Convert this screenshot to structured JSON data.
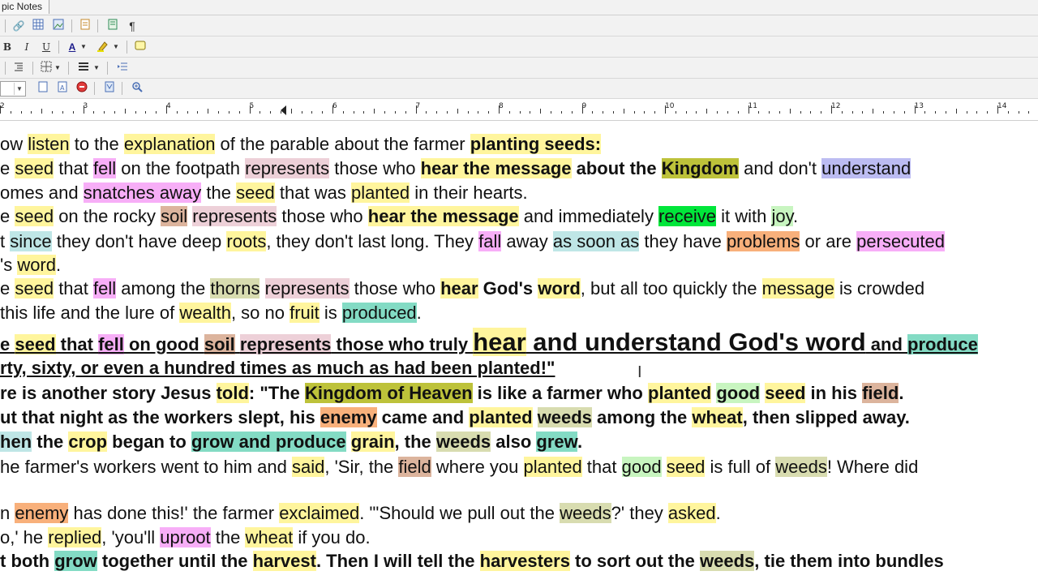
{
  "window": {
    "tab_title": "pic Notes"
  },
  "toolbar": {
    "bold": "B",
    "italic": "I",
    "underline": "U",
    "font_color": "A",
    "pilcrow": "¶"
  },
  "ruler": {
    "numbers": [
      "2",
      "3",
      "4",
      "5",
      "6",
      "7",
      "8",
      "9",
      "10",
      "11",
      "12",
      "13",
      "14"
    ]
  },
  "document": {
    "lines": [
      {
        "bold": false,
        "segments": [
          {
            "t": "ow ",
            "h": ""
          },
          {
            "t": "listen",
            "h": "hy"
          },
          {
            "t": " to the ",
            "h": ""
          },
          {
            "t": "explanation",
            "h": "hy"
          },
          {
            "t": " of the parable about the farmer ",
            "h": ""
          },
          {
            "t": "planting seeds:  ",
            "h": "hy",
            "b": true
          }
        ]
      },
      {
        "bold": false,
        "segments": [
          {
            "t": "e ",
            "h": ""
          },
          {
            "t": "seed",
            "h": "hy"
          },
          {
            "t": " that ",
            "h": ""
          },
          {
            "t": "fell",
            "h": "hp"
          },
          {
            "t": " on the footpath ",
            "h": ""
          },
          {
            "t": "represents",
            "h": "hr"
          },
          {
            "t": " those who ",
            "h": ""
          },
          {
            "t": "hear the message",
            "h": "hy",
            "b": true
          },
          {
            "t": " about the ",
            "h": "",
            "b": true
          },
          {
            "t": "Kingdom",
            "h": "hk",
            "b": true
          },
          {
            "t": " and don't ",
            "h": ""
          },
          {
            "t": "understand",
            "h": "hb"
          }
        ]
      },
      {
        "bold": false,
        "segments": [
          {
            "t": "omes and ",
            "h": ""
          },
          {
            "t": "snatches away",
            "h": "hp"
          },
          {
            "t": " the ",
            "h": ""
          },
          {
            "t": "seed",
            "h": "hy"
          },
          {
            "t": " that was ",
            "h": ""
          },
          {
            "t": "planted",
            "h": "hy"
          },
          {
            "t": " in their hearts.",
            "h": ""
          }
        ]
      },
      {
        "bold": false,
        "segments": [
          {
            "t": "e ",
            "h": ""
          },
          {
            "t": "seed",
            "h": "hy"
          },
          {
            "t": " on the rocky ",
            "h": ""
          },
          {
            "t": "soil",
            "h": "hbr"
          },
          {
            "t": " ",
            "h": ""
          },
          {
            "t": "represents",
            "h": "hr"
          },
          {
            "t": " those who ",
            "h": ""
          },
          {
            "t": "hear the message",
            "h": "hy",
            "b": true
          },
          {
            "t": " and immediately ",
            "h": ""
          },
          {
            "t": "receive",
            "h": "hg"
          },
          {
            "t": " it with ",
            "h": ""
          },
          {
            "t": "joy",
            "h": "hlg"
          },
          {
            "t": ".",
            "h": ""
          }
        ]
      },
      {
        "bold": false,
        "segments": [
          {
            "t": "t ",
            "h": ""
          },
          {
            "t": "since",
            "h": "hc"
          },
          {
            "t": " they don't have deep ",
            "h": ""
          },
          {
            "t": "roots",
            "h": "hy"
          },
          {
            "t": ", they don't last long. They ",
            "h": ""
          },
          {
            "t": "fall",
            "h": "hp"
          },
          {
            "t": " away ",
            "h": ""
          },
          {
            "t": "as soon as",
            "h": "hc"
          },
          {
            "t": " they have ",
            "h": ""
          },
          {
            "t": "problems",
            "h": "ho"
          },
          {
            "t": " or are ",
            "h": ""
          },
          {
            "t": "persecuted",
            "h": "hp"
          }
        ]
      },
      {
        "bold": false,
        "segments": [
          {
            "t": "'s ",
            "h": ""
          },
          {
            "t": "word",
            "h": "hy"
          },
          {
            "t": ".",
            "h": ""
          }
        ]
      },
      {
        "bold": false,
        "segments": [
          {
            "t": "e ",
            "h": ""
          },
          {
            "t": "seed",
            "h": "hy"
          },
          {
            "t": " that ",
            "h": ""
          },
          {
            "t": "fell",
            "h": "hp"
          },
          {
            "t": " among the ",
            "h": ""
          },
          {
            "t": "thorns",
            "h": "hol"
          },
          {
            "t": " ",
            "h": ""
          },
          {
            "t": "represents",
            "h": "hr"
          },
          {
            "t": " those who ",
            "h": ""
          },
          {
            "t": "hear",
            "h": "hy",
            "b": true
          },
          {
            "t": " God's ",
            "h": "",
            "b": true
          },
          {
            "t": "word",
            "h": "hy",
            "b": true
          },
          {
            "t": ", but all too quickly the ",
            "h": ""
          },
          {
            "t": "message",
            "h": "hy"
          },
          {
            "t": " is crowded",
            "h": ""
          }
        ]
      },
      {
        "bold": false,
        "segments": [
          {
            "t": " this life and the lure of ",
            "h": ""
          },
          {
            "t": "wealth",
            "h": "hy"
          },
          {
            "t": ", so no ",
            "h": ""
          },
          {
            "t": "fruit",
            "h": "hy"
          },
          {
            "t": " is ",
            "h": ""
          },
          {
            "t": "produced",
            "h": "ht"
          },
          {
            "t": ".",
            "h": ""
          }
        ]
      },
      {
        "bold": true,
        "segments": [
          {
            "t": "e ",
            "h": ""
          },
          {
            "t": "seed",
            "h": "hy"
          },
          {
            "t": " that ",
            "h": ""
          },
          {
            "t": "fell",
            "h": "hp"
          },
          {
            "t": " on good ",
            "h": ""
          },
          {
            "t": "soil",
            "h": "hbr"
          },
          {
            "t": " ",
            "h": ""
          },
          {
            "t": "represents",
            "h": "hr"
          },
          {
            "t": " those who truly ",
            "h": ""
          },
          {
            "t": "hear",
            "h": "hy",
            "big": true
          },
          {
            "t": " and understand God's word",
            "h": "",
            "big": true
          },
          {
            "t": " and ",
            "h": ""
          },
          {
            "t": "produce",
            "h": "ht"
          }
        ]
      },
      {
        "bold": true,
        "segments": [
          {
            "t": "rty, sixty, or even a hundred times as much as had been planted!\"",
            "h": ""
          }
        ]
      },
      {
        "bold": true,
        "segments": [
          {
            "t": "re is another story Jesus ",
            "h": ""
          },
          {
            "t": "told",
            "h": "hy"
          },
          {
            "t": ": \"The ",
            "h": ""
          },
          {
            "t": "Kingdom of Heaven",
            "h": "hk"
          },
          {
            "t": " is like a farmer who ",
            "h": ""
          },
          {
            "t": "planted",
            "h": "hy"
          },
          {
            "t": " ",
            "h": ""
          },
          {
            "t": "good",
            "h": "hlg"
          },
          {
            "t": " ",
            "h": ""
          },
          {
            "t": "seed",
            "h": "hy"
          },
          {
            "t": " in his ",
            "h": ""
          },
          {
            "t": "field",
            "h": "hbr"
          },
          {
            "t": ".",
            "h": ""
          }
        ]
      },
      {
        "bold": true,
        "segments": [
          {
            "t": "ut that night as the workers slept, his ",
            "h": ""
          },
          {
            "t": "enemy",
            "h": "ho"
          },
          {
            "t": " came and ",
            "h": ""
          },
          {
            "t": "planted",
            "h": "hy"
          },
          {
            "t": " ",
            "h": ""
          },
          {
            "t": "weeds",
            "h": "hol"
          },
          {
            "t": " among the ",
            "h": ""
          },
          {
            "t": "wheat",
            "h": "hy"
          },
          {
            "t": ", then slipped away.",
            "h": ""
          }
        ]
      },
      {
        "bold": true,
        "segments": [
          {
            "t": "hen",
            "h": "hc"
          },
          {
            "t": " the ",
            "h": ""
          },
          {
            "t": "crop",
            "h": "hy"
          },
          {
            "t": " began to ",
            "h": ""
          },
          {
            "t": "grow and produce",
            "h": "ht"
          },
          {
            "t": " ",
            "h": ""
          },
          {
            "t": "grain",
            "h": "hy"
          },
          {
            "t": ", the ",
            "h": ""
          },
          {
            "t": "weeds",
            "h": "hol"
          },
          {
            "t": " also ",
            "h": ""
          },
          {
            "t": "grew",
            "h": "ht"
          },
          {
            "t": ".",
            "h": ""
          }
        ]
      },
      {
        "bold": false,
        "segments": [
          {
            "t": "he farmer's workers went to him and ",
            "h": ""
          },
          {
            "t": "said",
            "h": "hy"
          },
          {
            "t": ", 'Sir, the ",
            "h": ""
          },
          {
            "t": "field",
            "h": "hbr"
          },
          {
            "t": " where you ",
            "h": ""
          },
          {
            "t": "planted",
            "h": "hy"
          },
          {
            "t": " that ",
            "h": ""
          },
          {
            "t": "good",
            "h": "hlg"
          },
          {
            "t": " ",
            "h": ""
          },
          {
            "t": "seed",
            "h": "hy"
          },
          {
            "t": " is full of ",
            "h": ""
          },
          {
            "t": "weeds",
            "h": "hol"
          },
          {
            "t": "! Where did",
            "h": ""
          }
        ]
      },
      {
        "bold": false,
        "segments": []
      },
      {
        "bold": false,
        "segments": [
          {
            "t": "n ",
            "h": ""
          },
          {
            "t": "enemy",
            "h": "ho"
          },
          {
            "t": " has done this!' the farmer ",
            "h": ""
          },
          {
            "t": "exclaimed",
            "h": "hy"
          },
          {
            "t": ". \"'Should we pull out the ",
            "h": ""
          },
          {
            "t": "weeds",
            "h": "hol"
          },
          {
            "t": "?' they ",
            "h": ""
          },
          {
            "t": "asked",
            "h": "hy"
          },
          {
            "t": ".",
            "h": ""
          }
        ]
      },
      {
        "bold": false,
        "segments": [
          {
            "t": "o,' he ",
            "h": ""
          },
          {
            "t": "replied",
            "h": "hy"
          },
          {
            "t": ", 'you'll ",
            "h": ""
          },
          {
            "t": "uproot",
            "h": "hp"
          },
          {
            "t": " the ",
            "h": ""
          },
          {
            "t": "wheat",
            "h": "hy"
          },
          {
            "t": " if you do.",
            "h": ""
          }
        ]
      },
      {
        "bold": true,
        "segments": [
          {
            "t": "t both ",
            "h": ""
          },
          {
            "t": "grow",
            "h": "ht"
          },
          {
            "t": " together until the ",
            "h": ""
          },
          {
            "t": "harvest",
            "h": "hy"
          },
          {
            "t": ". Then I will tell the ",
            "h": ""
          },
          {
            "t": "harvesters",
            "h": "hy"
          },
          {
            "t": " to sort out the ",
            "h": ""
          },
          {
            "t": "weeds",
            "h": "hol"
          },
          {
            "t": ", tie them into bundles",
            "h": ""
          }
        ]
      }
    ]
  }
}
